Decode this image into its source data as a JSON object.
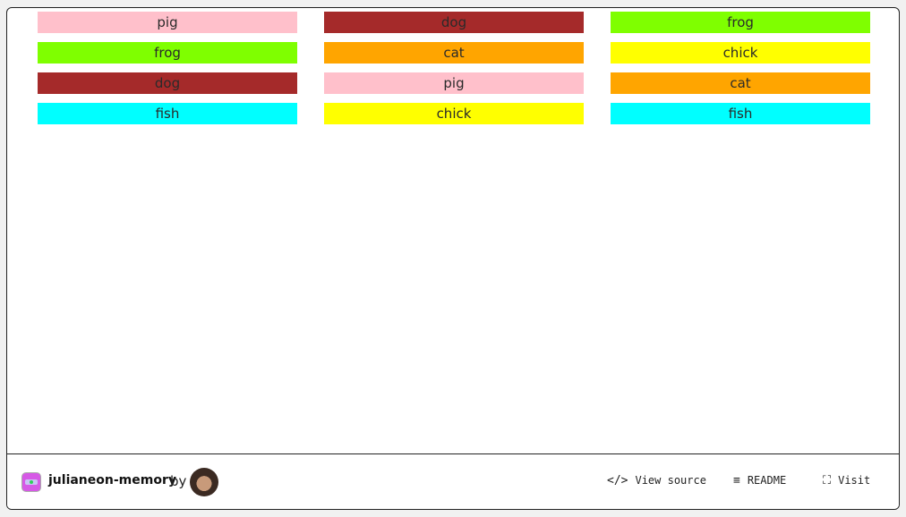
{
  "game": {
    "columns": [
      [
        {
          "label": "pig",
          "color": "#ffc0cb"
        },
        {
          "label": "frog",
          "color": "#7fff00"
        },
        {
          "label": "dog",
          "color": "#a52a2a"
        },
        {
          "label": "fish",
          "color": "#00ffff"
        }
      ],
      [
        {
          "label": "dog",
          "color": "#a52a2a"
        },
        {
          "label": "cat",
          "color": "#ffa500"
        },
        {
          "label": "pig",
          "color": "#ffc0cb"
        },
        {
          "label": "chick",
          "color": "#ffff00"
        }
      ],
      [
        {
          "label": "frog",
          "color": "#7fff00"
        },
        {
          "label": "chick",
          "color": "#ffff00"
        },
        {
          "label": "cat",
          "color": "#ffa500"
        },
        {
          "label": "fish",
          "color": "#00ffff"
        }
      ]
    ]
  },
  "footer": {
    "project_name": "julianeon-memory",
    "by": "by",
    "view_source": "View source",
    "readme": "README",
    "visit": "Visit",
    "icons": {
      "view_source": "code-icon",
      "readme": "menu-lines-icon",
      "visit": "fullscreen-icon"
    }
  }
}
